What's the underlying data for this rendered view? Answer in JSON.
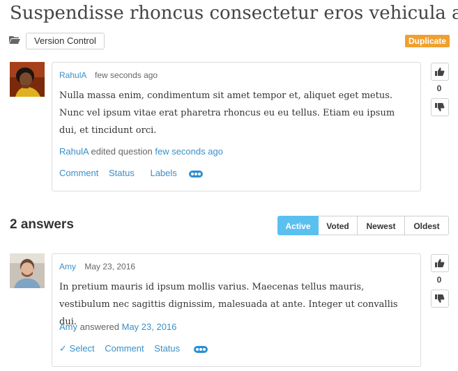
{
  "question": {
    "title": "Suspendisse rhoncus consectetur eros vehicula accumsan",
    "category": "Version Control",
    "status_badge": "Duplicate",
    "author": "RahulA",
    "time": "few seconds ago",
    "body": "Nulla massa enim, condimentum sit amet tempor et, aliquet eget metus. Nunc vel ipsum vitae erat pharetra rhoncus eu eu tellus. Etiam eu ipsum dui, et tincidunt orci.",
    "activity_user": "RahulA",
    "activity_action": "edited question",
    "activity_time": "few seconds ago",
    "actions": {
      "comment": "Comment",
      "status": "Status",
      "labels": "Labels"
    },
    "votes": "0"
  },
  "answers_heading": "2 answers",
  "sort_tabs": {
    "active": "Active",
    "voted": "Voted",
    "newest": "Newest",
    "oldest": "Oldest"
  },
  "answer": {
    "author": "Amy",
    "date": "May 23, 2016",
    "body": "In pretium mauris id ipsum mollis varius. Maecenas tellus mauris, vestibulum nec sagittis dignissim, malesuada at ante. Integer ut convallis dui.",
    "activity_user": "Amy",
    "activity_action": "answered",
    "activity_time": "May 23, 2016",
    "actions": {
      "select": "Select",
      "comment": "Comment",
      "status": "Status"
    },
    "votes": "0"
  },
  "colors": {
    "link": "#3a8fc7",
    "badge": "#f0a030",
    "active_tab": "#5bc0f0",
    "more_button": "#2c8fd0"
  }
}
